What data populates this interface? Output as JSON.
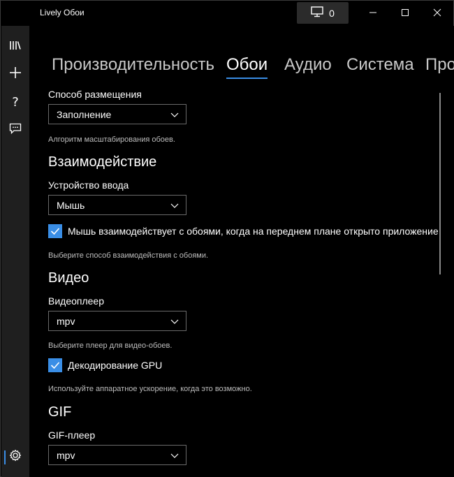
{
  "window": {
    "title": "Lively Обои"
  },
  "titlebar": {
    "screen_count": "0",
    "screen_icon": "monitor-icon"
  },
  "nav": {
    "icons": [
      "library-icon",
      "add-icon",
      "help-icon",
      "feedback-icon",
      "settings-icon"
    ]
  },
  "tabs": [
    "Производительность",
    "Обои",
    "Аудио",
    "Система",
    "Про"
  ],
  "active_tab": "Обои",
  "wallpaper": {
    "placement": {
      "label": "Способ размещения",
      "value": "Заполнение",
      "hint": "Алгоритм масштабирования обоев."
    }
  },
  "interaction": {
    "heading": "Взаимодействие",
    "input": {
      "label": "Устройство ввода",
      "value": "Мышь"
    },
    "mouse_checkbox": {
      "label": "Мышь взаимодействует с обоями, когда на переднем плане открыто приложение",
      "checked": true
    },
    "hint": "Выберите способ взаимодействия с обоями."
  },
  "video": {
    "heading": "Видео",
    "player": {
      "label": "Видеоплеер",
      "value": "mpv",
      "hint": "Выберите плеер для видео-обоев."
    },
    "gpu_checkbox": {
      "label": "Декодирование GPU",
      "checked": true,
      "hint": "Используйте аппаратное ускорение, когда это возможно."
    }
  },
  "gif": {
    "heading": "GIF",
    "player": {
      "label": "GIF-плеер",
      "value": "mpv"
    }
  },
  "colors": {
    "accent": "#3a8ee6",
    "background": "#000000",
    "rail": "#1f1f1f"
  }
}
